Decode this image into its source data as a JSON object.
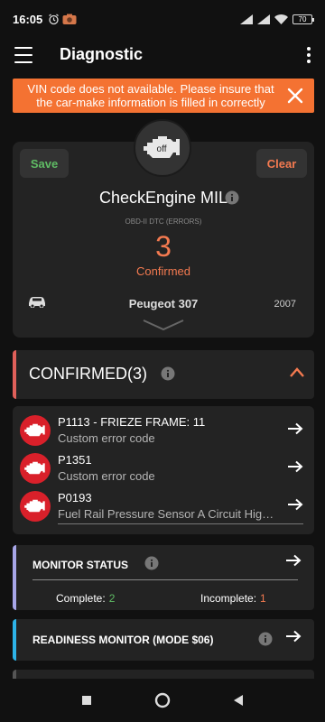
{
  "status_bar": {
    "time": "16:05",
    "battery": "70"
  },
  "app_bar": {
    "title": "Diagnostic"
  },
  "banner": {
    "text": "VIN code does not available. Please insure that the car-make information is filled in correctly"
  },
  "main_card": {
    "save_label": "Save",
    "clear_label": "Clear",
    "engine_state": "off",
    "title": "CheckEngine MIL",
    "subtitle": "OBD-II DTC (ERRORS)",
    "count": "3",
    "status": "Confirmed",
    "car_model": "Peugeot 307",
    "car_year": "2007"
  },
  "confirmed_section": {
    "title": "CONFIRMED(3)"
  },
  "errors": [
    {
      "code": "P1113 - FRIEZE FRAME: 11",
      "description": "Custom error code"
    },
    {
      "code": "P1351",
      "description": "Custom error code"
    },
    {
      "code": "P0193",
      "description": "Fuel Rail Pressure Sensor A Circuit High Input"
    }
  ],
  "monitor_status": {
    "title": "MONITOR STATUS",
    "complete_label": "Complete:",
    "complete_value": "2",
    "incomplete_label": "Incomplete:",
    "incomplete_value": "1"
  },
  "readiness_monitor": {
    "title": "READINESS MONITOR (MODE $06)"
  },
  "colors": {
    "accent_orange": "#f47232",
    "error_red": "#d9202a",
    "ok_green": "#5fbb64",
    "monitor_purple": "#a7a6e8",
    "readiness_blue": "#2db3e8"
  }
}
